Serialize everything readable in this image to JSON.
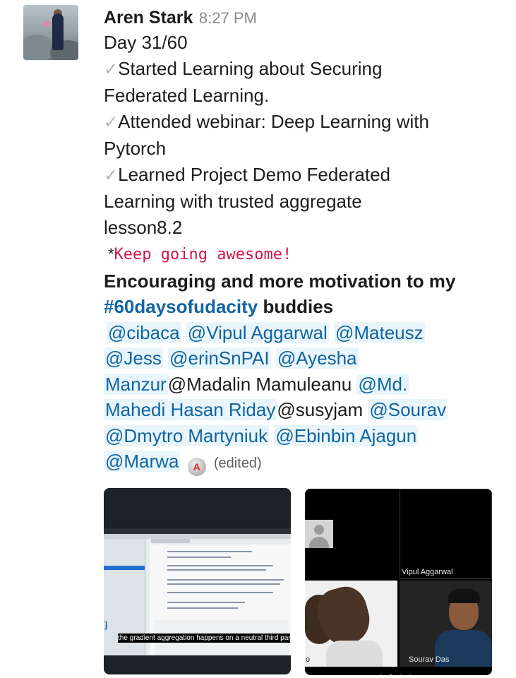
{
  "message": {
    "author": "Aren Stark",
    "time": "8:27 PM",
    "day": "Day 31/60",
    "checkmark": "✓",
    "items": [
      "Started Learning about Securing",
      "Federated Learning.",
      "Attended webinar: Deep Learning with",
      "Pytorch",
      "Learned Project Demo Federated",
      "Learning with trusted aggregate",
      "lesson8.2"
    ],
    "code_prefix": "*",
    "code_text": "Keep going awesome!",
    "bold_line1": "Encouraging and more motivation to my",
    "hashtag": "#60daysofudacity",
    "bold_line2_rest": " buddies",
    "mentions": {
      "cibaca": "@cibaca",
      "vipul": "@Vipul Aggarwal",
      "mateusz": "@Mateusz",
      "jess": "@Jess",
      "erin": "@erinSnPAI",
      "ayesha_1": "@Ayesha",
      "ayesha_2": "Manzur",
      "madalin": "@Madalin Mamuleanu",
      "md_1": "@Md.",
      "md_2": "Mahedi Hasan Riday",
      "susy": "@susyjam",
      "sourav": "@Sourav",
      "dmytro": "@Dmytro Martyniuk",
      "ebinbin": "@Ebinbin Ajagun",
      "marwa": "@Marwa"
    },
    "edited_icon": "A",
    "edited": "(edited)"
  },
  "attachments": {
    "screenshot_caption": "the gradient aggregation happens on a neutral third party.",
    "video_call": {
      "participant_1": "Vipul Aggarwal",
      "participant_2": "Sourav Das",
      "participant_3_label": "o"
    }
  },
  "colors": {
    "link": "#1264a3",
    "mention_bg": "#e8f5fa",
    "code": "#d0174a"
  },
  "icons": [
    "avatar",
    "checkmark-icon",
    "edited-badge-icon",
    "user-placeholder-icon"
  ]
}
